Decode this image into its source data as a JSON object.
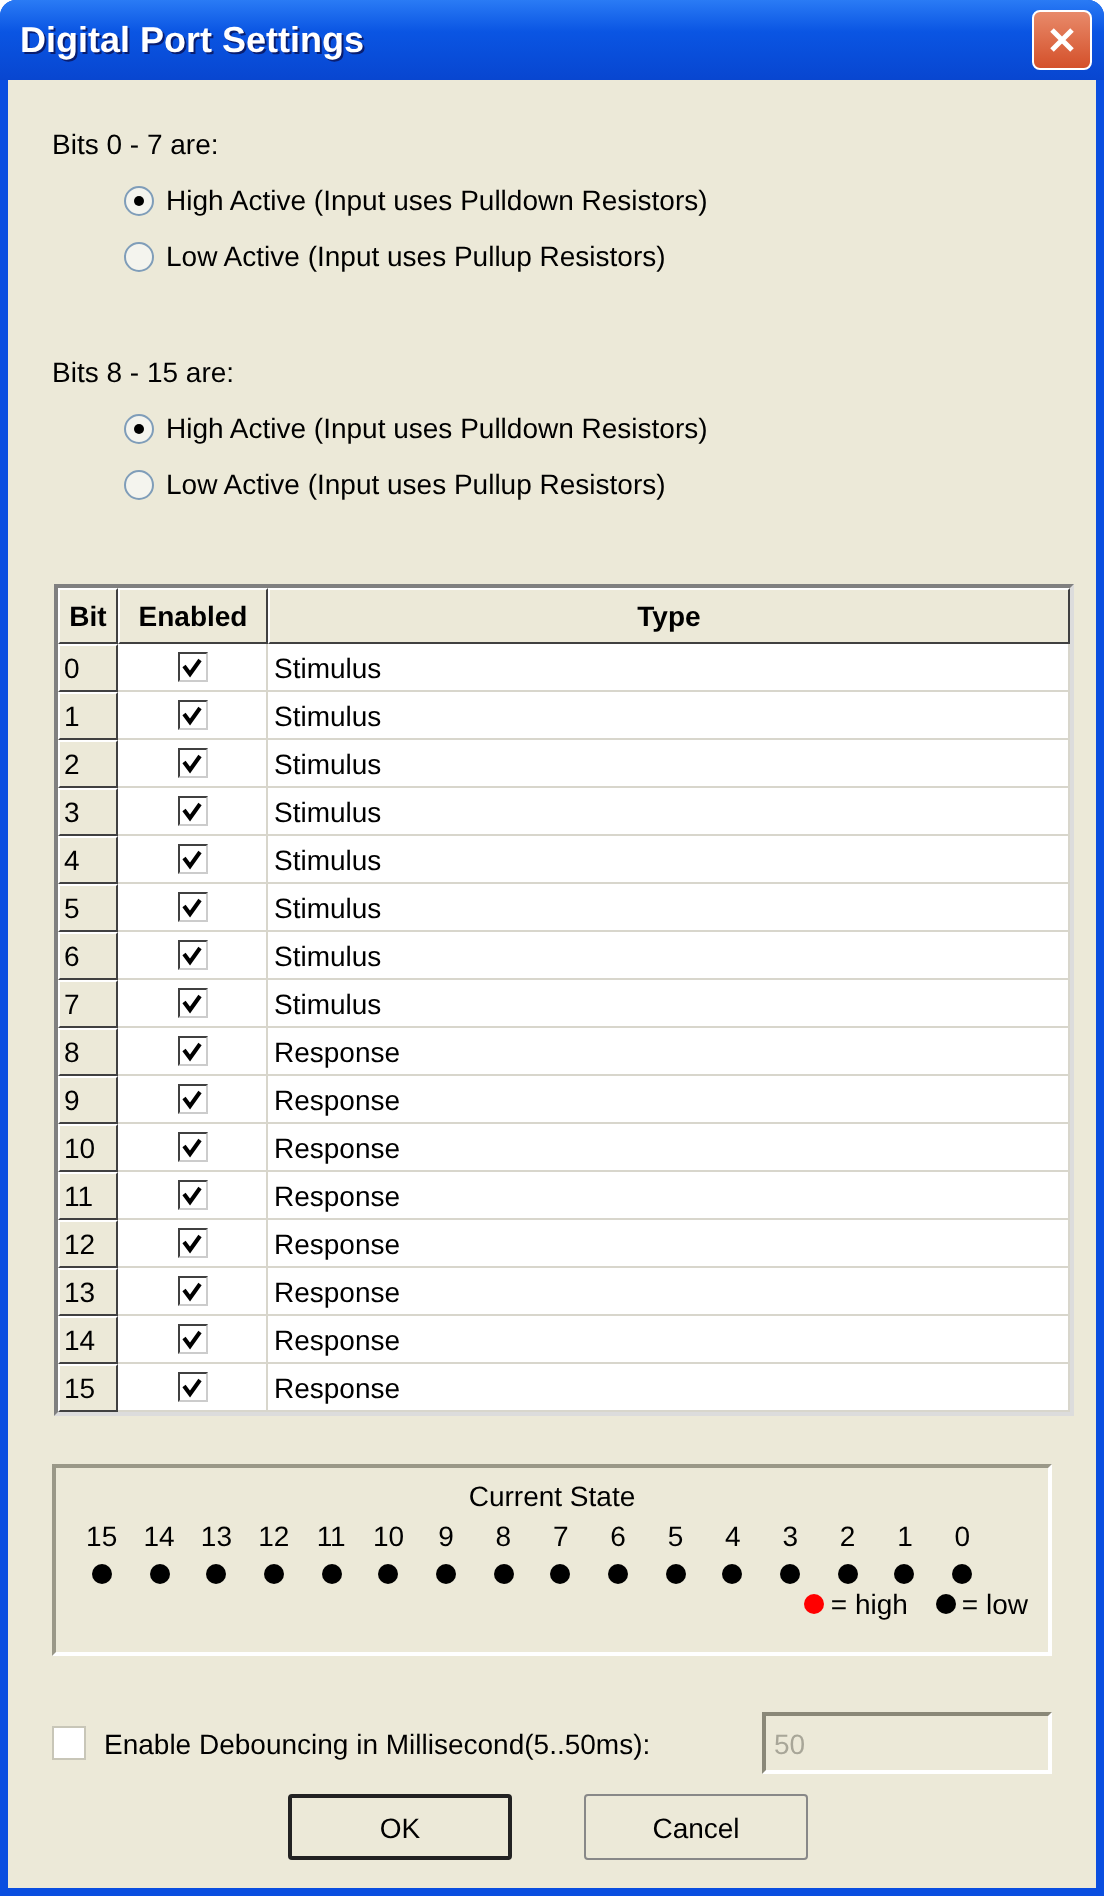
{
  "window": {
    "title": "Digital Port Settings"
  },
  "bit_groups": [
    {
      "label": "Bits 0 - 7 are:",
      "options": [
        {
          "label": "High Active (Input uses Pulldown Resistors)",
          "selected": true
        },
        {
          "label": "Low Active (Input uses Pullup Resistors)",
          "selected": false
        }
      ]
    },
    {
      "label": "Bits 8 - 15 are:",
      "options": [
        {
          "label": "High Active (Input uses Pulldown Resistors)",
          "selected": true
        },
        {
          "label": "Low Active (Input uses Pullup Resistors)",
          "selected": false
        }
      ]
    }
  ],
  "table": {
    "columns": [
      "Bit",
      "Enabled",
      "Type"
    ],
    "rows": [
      {
        "bit": "0",
        "enabled": true,
        "type": "Stimulus"
      },
      {
        "bit": "1",
        "enabled": true,
        "type": "Stimulus"
      },
      {
        "bit": "2",
        "enabled": true,
        "type": "Stimulus"
      },
      {
        "bit": "3",
        "enabled": true,
        "type": "Stimulus"
      },
      {
        "bit": "4",
        "enabled": true,
        "type": "Stimulus"
      },
      {
        "bit": "5",
        "enabled": true,
        "type": "Stimulus"
      },
      {
        "bit": "6",
        "enabled": true,
        "type": "Stimulus"
      },
      {
        "bit": "7",
        "enabled": true,
        "type": "Stimulus"
      },
      {
        "bit": "8",
        "enabled": true,
        "type": "Response"
      },
      {
        "bit": "9",
        "enabled": true,
        "type": "Response"
      },
      {
        "bit": "10",
        "enabled": true,
        "type": "Response"
      },
      {
        "bit": "11",
        "enabled": true,
        "type": "Response"
      },
      {
        "bit": "12",
        "enabled": true,
        "type": "Response"
      },
      {
        "bit": "13",
        "enabled": true,
        "type": "Response"
      },
      {
        "bit": "14",
        "enabled": true,
        "type": "Response"
      },
      {
        "bit": "15",
        "enabled": true,
        "type": "Response"
      }
    ]
  },
  "current_state": {
    "title": "Current State",
    "bits": [
      {
        "label": "15",
        "high": false
      },
      {
        "label": "14",
        "high": false
      },
      {
        "label": "13",
        "high": false
      },
      {
        "label": "12",
        "high": false
      },
      {
        "label": "11",
        "high": false
      },
      {
        "label": "10",
        "high": false
      },
      {
        "label": "9",
        "high": false
      },
      {
        "label": "8",
        "high": false
      },
      {
        "label": "7",
        "high": false
      },
      {
        "label": "6",
        "high": false
      },
      {
        "label": "5",
        "high": false
      },
      {
        "label": "4",
        "high": false
      },
      {
        "label": "3",
        "high": false
      },
      {
        "label": "2",
        "high": false
      },
      {
        "label": "1",
        "high": false
      },
      {
        "label": "0",
        "high": false
      }
    ],
    "legend": [
      {
        "color": "#ff0000",
        "label": "= high"
      },
      {
        "color": "#000000",
        "label": "= low"
      }
    ]
  },
  "debounce": {
    "label": "Enable Debouncing in Millisecond(5..50ms):",
    "checked": false,
    "value": "50",
    "disabled": true
  },
  "buttons": [
    {
      "label": "OK",
      "default": true
    },
    {
      "label": "Cancel",
      "default": false
    }
  ]
}
